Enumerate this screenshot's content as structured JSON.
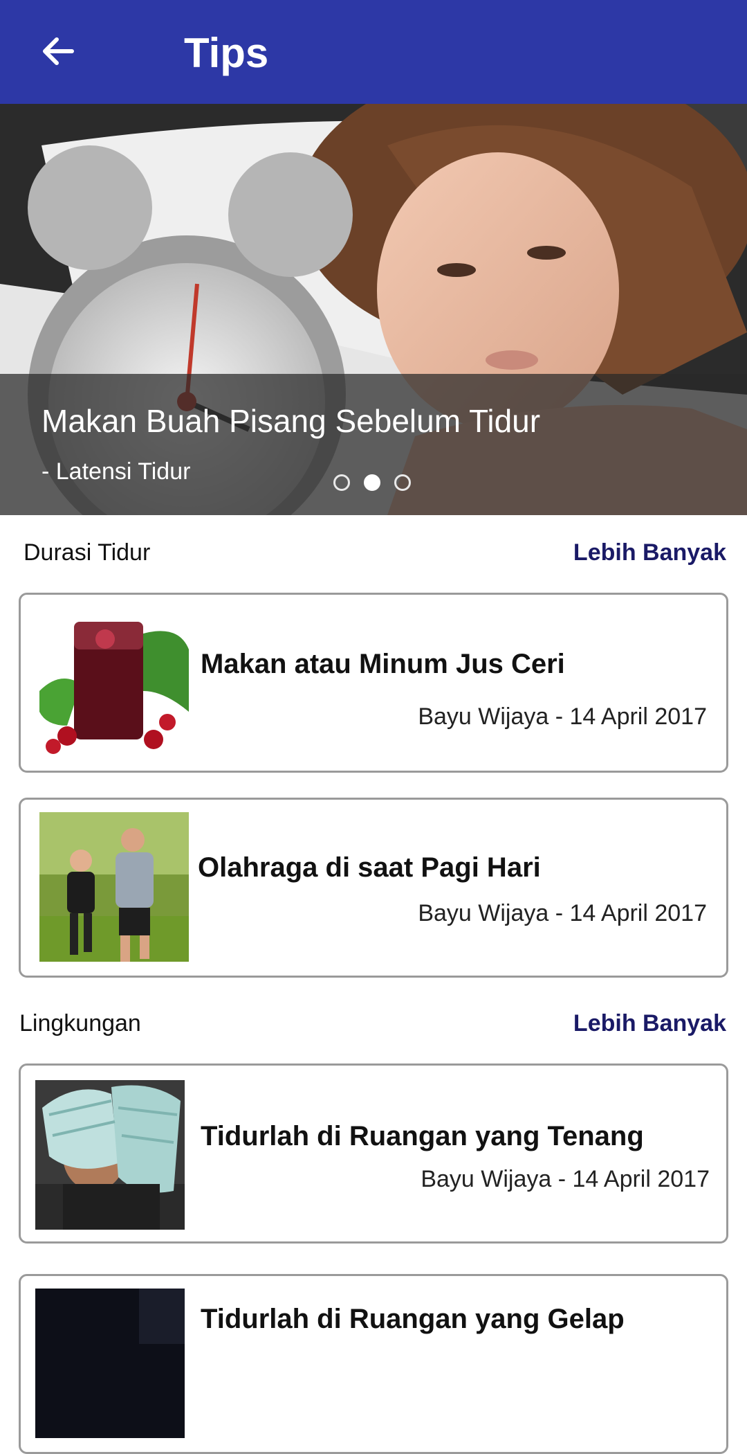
{
  "app_bar": {
    "title": "Tips",
    "back_icon": "arrow-left-icon",
    "color": "#2d38a6"
  },
  "hero": {
    "title": "Makan Buah Pisang Sebelum Tidur",
    "subtitle": "- Latensi Tidur",
    "slide_count": 3,
    "active_slide": 2
  },
  "sections": [
    {
      "label": "Durasi Tidur",
      "more_label": "Lebih Banyak",
      "articles": [
        {
          "title": "Makan atau Minum Jus Ceri",
          "meta": "Bayu Wijaya - 14 April 2017"
        },
        {
          "title": "Olahraga di saat Pagi Hari",
          "meta": "Bayu Wijaya - 14 April 2017"
        }
      ]
    },
    {
      "label": "Lingkungan",
      "more_label": "Lebih Banyak",
      "articles": [
        {
          "title": "Tidurlah di Ruangan yang Tenang",
          "meta": "Bayu Wijaya - 14 April 2017"
        },
        {
          "title": "Tidurlah di Ruangan yang Gelap",
          "meta": ""
        }
      ]
    }
  ]
}
